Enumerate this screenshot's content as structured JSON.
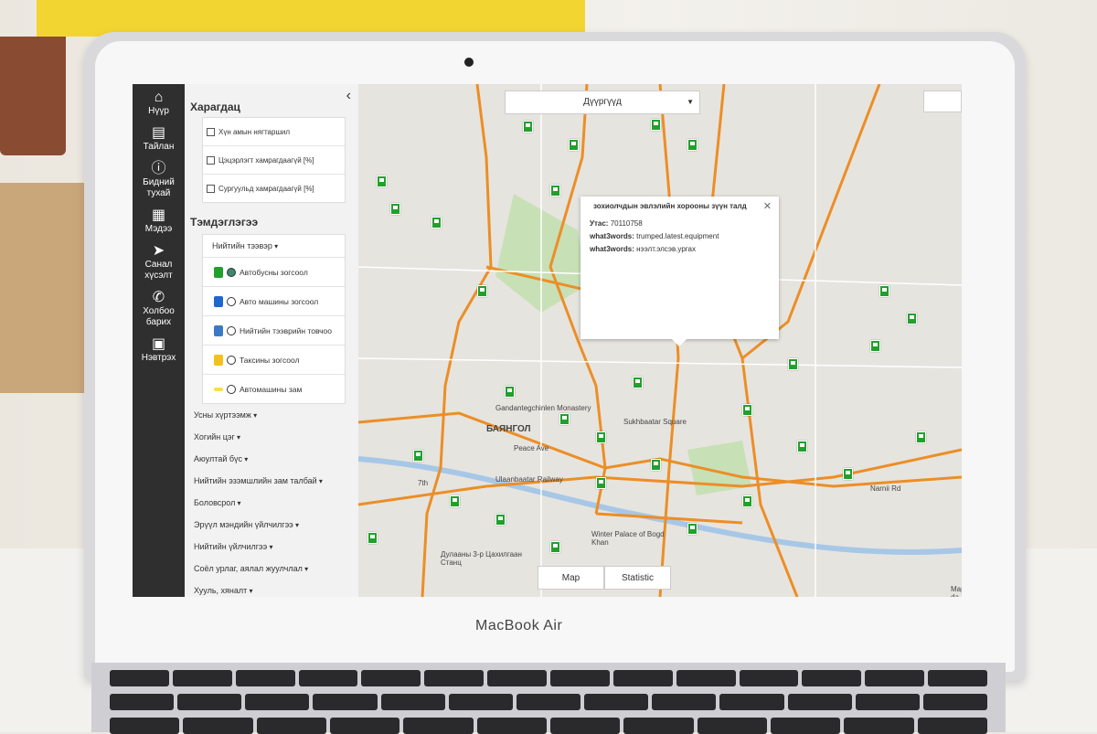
{
  "navigation": [
    {
      "label": "Нүүр",
      "icon": "home-icon"
    },
    {
      "label": "Тайлан",
      "icon": "report-icon"
    },
    {
      "label": "Бидний тухай",
      "icon": "info-icon"
    },
    {
      "label": "Мэдээ",
      "icon": "news-icon"
    },
    {
      "label": "Санал хүсэлт",
      "icon": "send-icon"
    },
    {
      "label": "Холбоо барих",
      "icon": "phone-icon"
    },
    {
      "label": "Нэвтрэх",
      "icon": "login-icon"
    }
  ],
  "panel": {
    "view_title": "Харагдац",
    "view_options": [
      "Хүн амын нягтаршил",
      "Цэцэрлэгт хамрагдаагүй [%]",
      "Сургуульд хамрагдаагүй [%]"
    ],
    "legend_title": "Тэмдэглэгээ",
    "public_transport_label": "Нийтийн тээвэр",
    "legend_items": [
      {
        "label": "Автобусны зогсоол",
        "color": "#21a02c",
        "selected": true
      },
      {
        "label": "Авто машины зогсоол",
        "color": "#1e66d0",
        "selected": false
      },
      {
        "label": "Нийтийн тээврийн товчоо",
        "color": "#3a79c8",
        "selected": false
      },
      {
        "label": "Таксины зогсоол",
        "color": "#f1c21b",
        "selected": false
      },
      {
        "label": "Автомашины зам",
        "color": "#f6e04b",
        "selected": false
      }
    ],
    "categories": [
      "Усны хүртээмж",
      "Хогийн цэг",
      "Аюултай бүс",
      "Нийтийн эзэмшлийн зам талбай",
      "Боловсрол",
      "Эрүүл мэндийн үйлчилгээ",
      "Нийтийн үйлчилгээ",
      "Соёл урлаг, аялал жуулчлал",
      "Хууль, хяналт"
    ]
  },
  "map": {
    "district_dropdown": "Дүүргүүд",
    "popup": {
      "title": "зохиолчдын эвлэлийн хорооны зүүн талд",
      "phone_label": "Утас:",
      "phone": "70110758",
      "w3w_label_1": "what3words:",
      "w3w_value_1": "trumped.latest.equipment",
      "w3w_label_2": "what3words:",
      "w3w_value_2": "нээлт.элсэв.ургах"
    },
    "tabs": [
      "Map",
      "Statistic"
    ],
    "labels": {
      "bayangol": "БАЯНГОЛ",
      "monastery": "Gandantegchinlen Monastery",
      "sukhbaatar": "Sukhbaatar Square",
      "railway": "Ulaanbaatar Railway",
      "winter_palace": "Winter Palace of Bogd Khan",
      "power": "Дулааны 3-р Цахилгаан Станц",
      "peace": "Peace Ave",
      "narnii": "Narnii Rd",
      "seventh": "7th",
      "attribution": "Map da"
    }
  },
  "device": {
    "brand": "MacBook Air"
  },
  "colors": {
    "road": "#ec8e26",
    "marker": "#21a02c",
    "park": "#c8e0b6",
    "river": "#a7c7e7",
    "nav_bg": "#2f2f2f"
  }
}
